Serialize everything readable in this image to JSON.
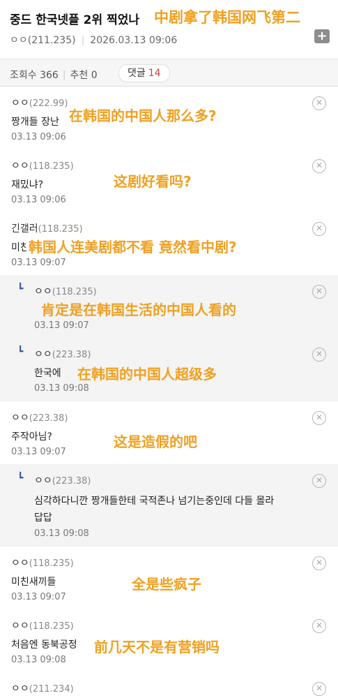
{
  "post": {
    "title": "중드 한국넷플 2위 찍었나",
    "title_overlay": "中剧拿了韩国网飞第二",
    "author": "ㅇㅇ(211.235)",
    "date": "2026.03.13 09:06",
    "add_label": "+"
  },
  "stats": {
    "views_label": "조회수 366",
    "recommend_label": "추천 0",
    "comments_label": "댓글",
    "comments_count": "14"
  },
  "comments": [
    {
      "name": "ㅇㅇ",
      "ip": "(222.99)",
      "text": "짱개들 장난",
      "overlay": "在韩国的中国人那么多?",
      "date": "03.13 09:06"
    },
    {
      "name": "ㅇㅇ",
      "ip": "(118.235)",
      "text": "재밌냐?",
      "overlay": "这剧好看吗?",
      "date": "03.13 09:06"
    },
    {
      "name": "긴갤러",
      "ip": "(118.235)",
      "text": "미친",
      "overlay": "韩国人连美剧都不看 竟然看中剧?",
      "date": "03.13 09:07"
    },
    {
      "name": "ㅇㅇ",
      "ip": "(118.235)",
      "text": "",
      "overlay": "肯定是在韩国生活的中国人看的",
      "date": "03.13 09:07"
    },
    {
      "name": "ㅇㅇ",
      "ip": "(223.38)",
      "text": "한국에",
      "overlay": "在韩国的中国人超级多",
      "date": "03.13 09:08"
    },
    {
      "name": "ㅇㅇ",
      "ip": "(223.38)",
      "text": "주작아님?",
      "overlay": "这是造假的吧",
      "date": "03.13 09:07"
    },
    {
      "name": "ㅇㅇ",
      "ip": "(223.38)",
      "text": "심각하다니깐 짱개들한테 국적존나 넘기는중인데 다들 몰라",
      "text2": "답답",
      "date": "03.13 09:08"
    },
    {
      "name": "ㅇㅇ",
      "ip": "(118.235)",
      "text": "미친새끼들",
      "overlay": "全是些疯子",
      "date": "03.13 09:07"
    },
    {
      "name": "ㅇㅇ",
      "ip": "(118.235)",
      "text": "처음엔 동북공정",
      "overlay": "前几天不是有营销吗",
      "date": "03.13 09:08"
    },
    {
      "name": "ㅇㅇ",
      "ip": "(211.234)"
    }
  ],
  "icons": {
    "delete": "close-circle-icon",
    "reply": "reply-arrow-icon",
    "plus": "plus-icon"
  },
  "colors": {
    "overlay_text": "#f0a020",
    "comment_count": "#d23c3c",
    "reply_arrow": "#3b5ba9",
    "reply_bg": "#f4f4f4"
  }
}
